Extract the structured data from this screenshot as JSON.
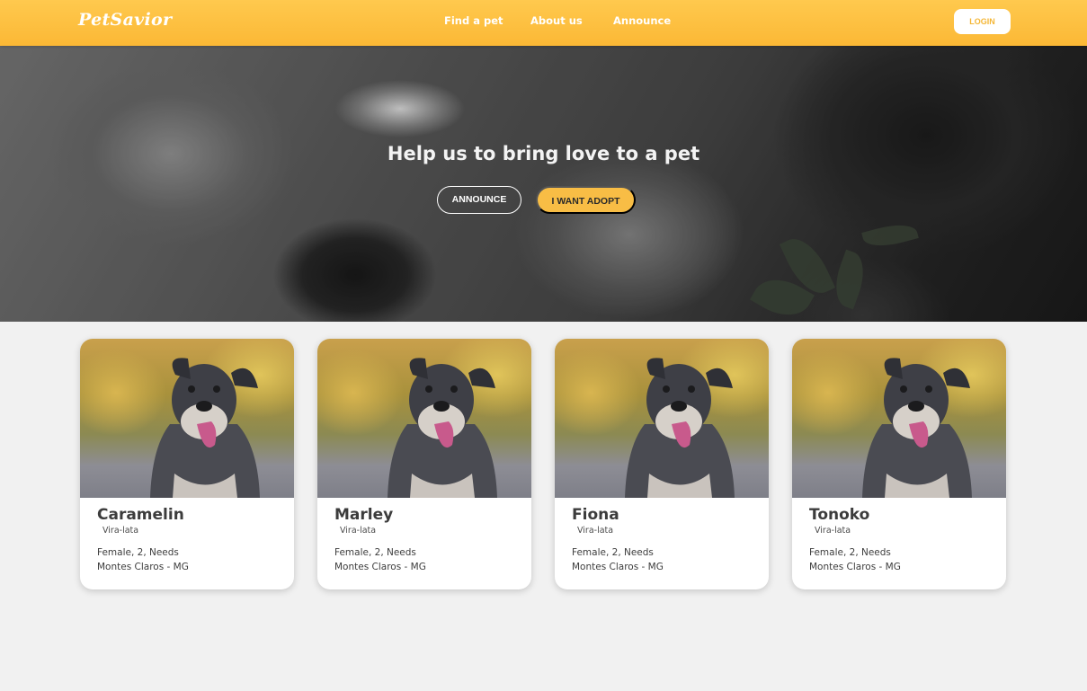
{
  "header": {
    "logo": "PetSavior",
    "nav": [
      "Find a pet",
      "About us",
      "Announce"
    ],
    "login_label": "LOGIN"
  },
  "hero": {
    "title": "Help us to bring love to a pet",
    "announce_label": "ANNOUNCE",
    "adopt_label": "I WANT ADOPT"
  },
  "pets": [
    {
      "name": "Caramelin",
      "breed": "Vira-lata",
      "info": "Female, 2, Needs",
      "location": "Montes Claros - MG"
    },
    {
      "name": "Marley",
      "breed": "Vira-lata",
      "info": "Female, 2, Needs",
      "location": "Montes Claros - MG"
    },
    {
      "name": "Fiona",
      "breed": "Vira-lata",
      "info": "Female, 2, Needs",
      "location": "Montes Claros - MG"
    },
    {
      "name": "Tonoko",
      "breed": "Vira-lata",
      "info": "Female, 2, Needs",
      "location": "Montes Claros - MG"
    }
  ],
  "colors": {
    "brand": "#fbb835",
    "background": "#f1f1f1",
    "text": "#3c3c3c"
  }
}
